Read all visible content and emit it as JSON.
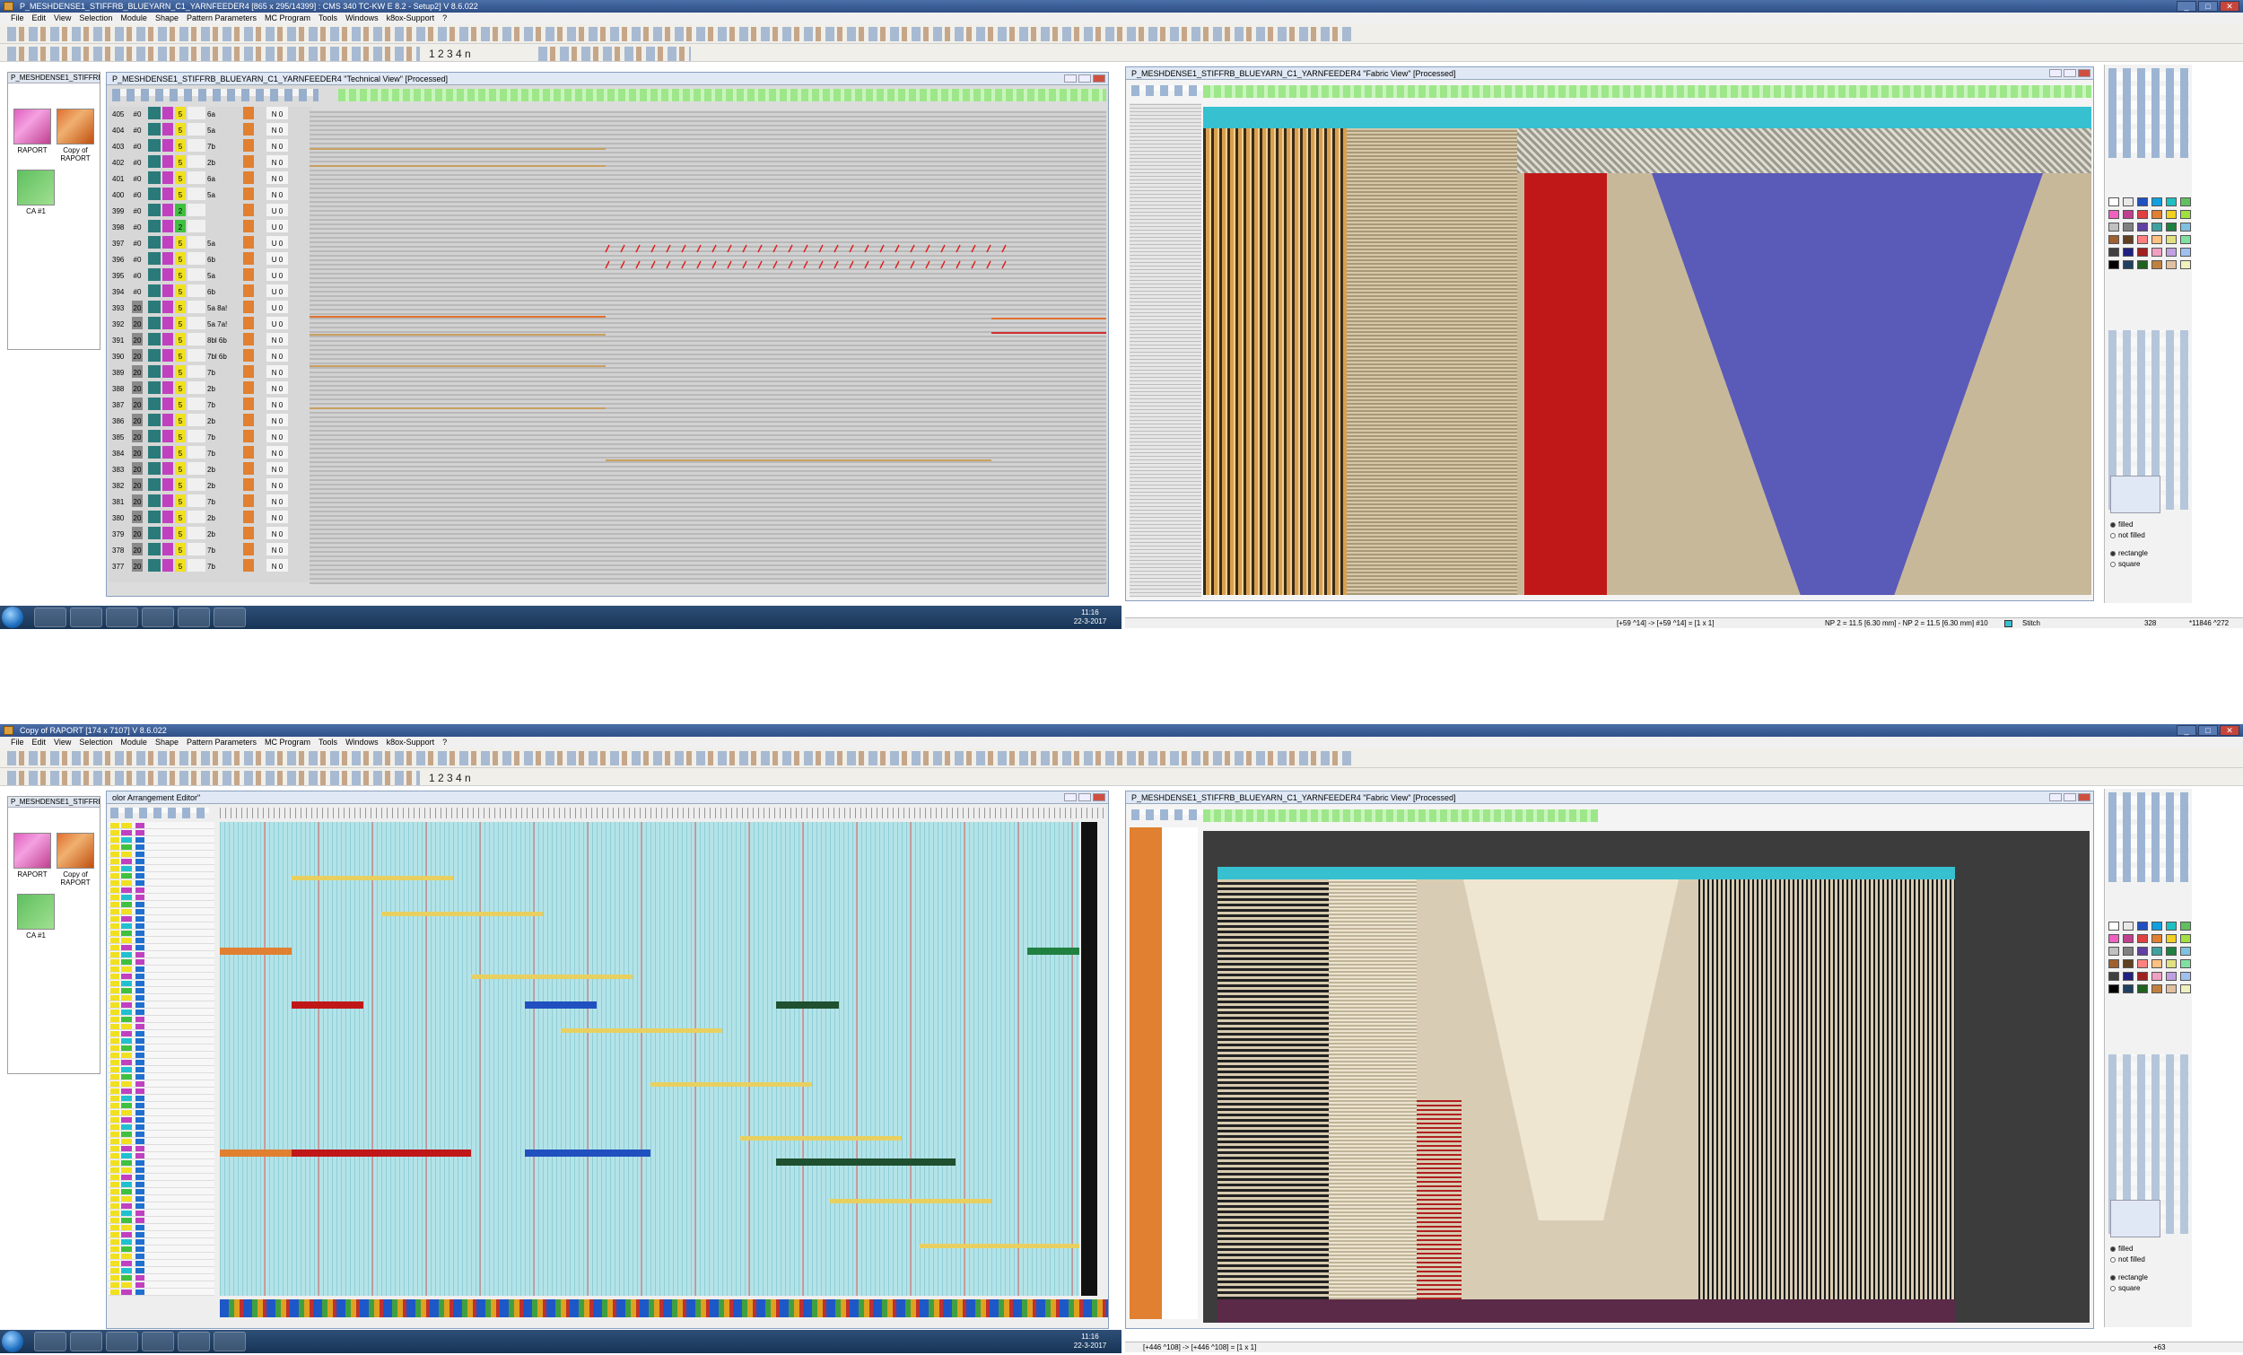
{
  "colors": {
    "accent": "#2f4f86",
    "taskbar": "#173456",
    "fabric_blue": "#5a5ab8",
    "fabric_red": "#c01818",
    "fabric_cyan": "#36c0d0"
  },
  "top": {
    "title": "P_MESHDENSE1_STIFFRB_BLUEYARN_C1_YARNFEEDER4 [865 x 295/14399] : CMS 340 TC-KW E 8.2 - Setup2] V 8.6.022",
    "menu": [
      "File",
      "Edit",
      "View",
      "Selection",
      "Module",
      "Shape",
      "Pattern Parameters",
      "MC Program",
      "Tools",
      "Windows",
      "k8ox-Support",
      "?"
    ],
    "toolbar_text": "1  2  3  4  n",
    "panel_title": "P_MESHDENSE1_STIFFRB",
    "thumbs": [
      "RAPORT",
      "Copy of RAPORT",
      "CA #1"
    ],
    "tech_title": "P_MESHDENSE1_STIFFRB_BLUEYARN_C1_YARNFEEDER4 \"Technical View\" [Processed]",
    "fabric_title": "P_MESHDENSE1_STIFFRB_BLUEYARN_C1_YARNFEEDER4 \"Fabric View\" [Processed]",
    "rows": [
      {
        "n": "405",
        "a": "#0",
        "m": "5",
        "t": "6a",
        "s": "N 0"
      },
      {
        "n": "404",
        "a": "#0",
        "m": "5",
        "t": "5a",
        "s": "N 0"
      },
      {
        "n": "403",
        "a": "#0",
        "m": "5",
        "t": "7b",
        "s": "N 0"
      },
      {
        "n": "402",
        "a": "#0",
        "m": "5",
        "t": "2b",
        "s": "N 0"
      },
      {
        "n": "401",
        "a": "#0",
        "m": "5",
        "t": "6a",
        "s": "N 0"
      },
      {
        "n": "400",
        "a": "#0",
        "m": "5",
        "t": "5a",
        "s": "N 0"
      },
      {
        "n": "399",
        "a": "#0",
        "m": "2",
        "t": "",
        "s": "U 0"
      },
      {
        "n": "398",
        "a": "#0",
        "m": "2",
        "t": "",
        "s": "U 0"
      },
      {
        "n": "397",
        "a": "#0",
        "m": "5",
        "t": "5a",
        "s": "U 0"
      },
      {
        "n": "396",
        "a": "#0",
        "m": "5",
        "t": "6b",
        "s": "U 0"
      },
      {
        "n": "395",
        "a": "#0",
        "m": "5",
        "t": "5a",
        "s": "U 0"
      },
      {
        "n": "394",
        "a": "#0",
        "m": "5",
        "t": "6b",
        "s": "U 0"
      },
      {
        "n": "393",
        "a": "20",
        "m": "5",
        "t": "5a 8a!",
        "s": "U 0"
      },
      {
        "n": "392",
        "a": "20",
        "m": "5",
        "t": "5a 7a!",
        "s": "U 0"
      },
      {
        "n": "391",
        "a": "20",
        "m": "5",
        "t": "8bl 6b",
        "s": "N 0"
      },
      {
        "n": "390",
        "a": "20",
        "m": "5",
        "t": "7bl 6b",
        "s": "N 0"
      },
      {
        "n": "389",
        "a": "20",
        "m": "5",
        "t": "7b",
        "s": "N 0"
      },
      {
        "n": "388",
        "a": "20",
        "m": "5",
        "t": "2b",
        "s": "N 0"
      },
      {
        "n": "387",
        "a": "20",
        "m": "5",
        "t": "7b",
        "s": "N 0"
      },
      {
        "n": "386",
        "a": "20",
        "m": "5",
        "t": "2b",
        "s": "N 0"
      },
      {
        "n": "385",
        "a": "20",
        "m": "5",
        "t": "7b",
        "s": "N 0"
      },
      {
        "n": "384",
        "a": "20",
        "m": "5",
        "t": "7b",
        "s": "N 0"
      },
      {
        "n": "383",
        "a": "20",
        "m": "5",
        "t": "2b",
        "s": "N 0"
      },
      {
        "n": "382",
        "a": "20",
        "m": "5",
        "t": "2b",
        "s": "N 0"
      },
      {
        "n": "381",
        "a": "20",
        "m": "5",
        "t": "7b",
        "s": "N 0"
      },
      {
        "n": "380",
        "a": "20",
        "m": "5",
        "t": "2b",
        "s": "N 0"
      },
      {
        "n": "379",
        "a": "20",
        "m": "5",
        "t": "2b",
        "s": "N 0"
      },
      {
        "n": "378",
        "a": "20",
        "m": "5",
        "t": "7b",
        "s": "N 0"
      },
      {
        "n": "377",
        "a": "20",
        "m": "5",
        "t": "7b",
        "s": "N 0"
      }
    ],
    "status_left": "[+59 ^14] -> [+59 ^14] = [1 x 1]",
    "status_mid": "NP 2 = 11.5 [6.30 mm] - NP 2 = 11.5 [6.30 mm]  #10",
    "status_stitch": "Stitch",
    "status_right1": "328",
    "status_right2": "*11846 ^272",
    "clock_time": "11:16",
    "clock_date": "22-3-2017",
    "radio_filled": "filled",
    "radio_notfilled": "not filled",
    "radio_rect": "rectangle",
    "radio_square": "square"
  },
  "bottom": {
    "title": "Copy of RAPORT [174 x 7107] V 8.6.022",
    "menu": [
      "File",
      "Edit",
      "View",
      "Selection",
      "Module",
      "Shape",
      "Pattern Parameters",
      "MC Program",
      "Tools",
      "Windows",
      "k8ox-Support",
      "?"
    ],
    "toolbar_text": "1  2  3  4  n",
    "panel_title": "P_MESHDENSE1_STIFFRB",
    "thumbs": [
      "RAPORT",
      "Copy of RAPORT",
      "CA #1"
    ],
    "cae_title": "olor Arrangement Editor\"",
    "fabric_title": "P_MESHDENSE1_STIFFRB_BLUEYARN_C1_YARNFEEDER4 \"Fabric View\" [Processed]",
    "status_left": "[+446 ^108] -> [+446 ^108] = [1 x 1]",
    "status_right": "+63",
    "clock_time": "11:16",
    "clock_date": "22-3-2017",
    "radio_filled": "filled",
    "radio_notfilled": "not filled",
    "radio_rect": "rectangle",
    "radio_square": "square"
  }
}
